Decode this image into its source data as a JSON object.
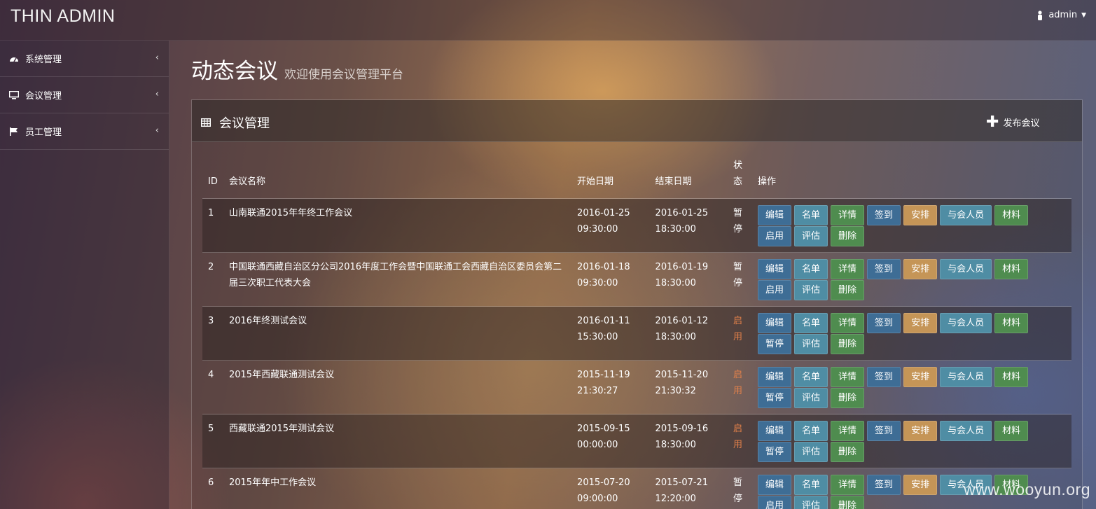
{
  "app": {
    "brand": "THIN ADMIN",
    "user": "admin"
  },
  "sidebar": {
    "items": [
      {
        "label": "系统管理",
        "icon": "dashboard-icon"
      },
      {
        "label": "会议管理",
        "icon": "desktop-icon"
      },
      {
        "label": "员工管理",
        "icon": "flag-icon"
      }
    ]
  },
  "page": {
    "title": "动态会议",
    "subtitle": "欢迎使用会议管理平台"
  },
  "panel": {
    "title": "会议管理",
    "icon": "table-icon",
    "publish_label": "发布会议"
  },
  "table": {
    "headers": {
      "id": "ID",
      "name": "会议名称",
      "start": "开始日期",
      "end": "结束日期",
      "status": "状态",
      "ops": "操作"
    },
    "rows": [
      {
        "id": "1",
        "name": "山南联通2015年年终工作会议",
        "start": "2016-01-25 09:30:00",
        "end": "2016-01-25 18:30:00",
        "status": "暂停",
        "toggle": "启用"
      },
      {
        "id": "2",
        "name": "中国联通西藏自治区分公司2016年度工作会暨中国联通工会西藏自治区委员会第二届三次职工代表大会",
        "start": "2016-01-18 09:30:00",
        "end": "2016-01-19 18:30:00",
        "status": "暂停",
        "toggle": "启用"
      },
      {
        "id": "3",
        "name": "2016年终测试会议",
        "start": "2016-01-11 15:30:00",
        "end": "2016-01-12 18:30:00",
        "status": "启用",
        "toggle": "暂停"
      },
      {
        "id": "4",
        "name": "2015年西藏联通测试会议",
        "start": "2015-11-19 21:30:27",
        "end": "2015-11-20 21:30:32",
        "status": "启用",
        "toggle": "暂停"
      },
      {
        "id": "5",
        "name": "西藏联通2015年测试会议",
        "start": "2015-09-15 00:00:00",
        "end": "2015-09-16 18:30:00",
        "status": "启用",
        "toggle": "暂停"
      },
      {
        "id": "6",
        "name": "2015年年中工作会议",
        "start": "2015-07-20 09:00:00",
        "end": "2015-07-21 12:20:00",
        "status": "暂停",
        "toggle": "启用"
      }
    ],
    "actions": {
      "edit": "编辑",
      "list": "名单",
      "detail": "详情",
      "signin": "签到",
      "arrange": "安排",
      "attendees": "与会人员",
      "material": "材料",
      "evaluate": "评估",
      "delete": "删除"
    }
  },
  "watermark": "www.wooyun.org"
}
